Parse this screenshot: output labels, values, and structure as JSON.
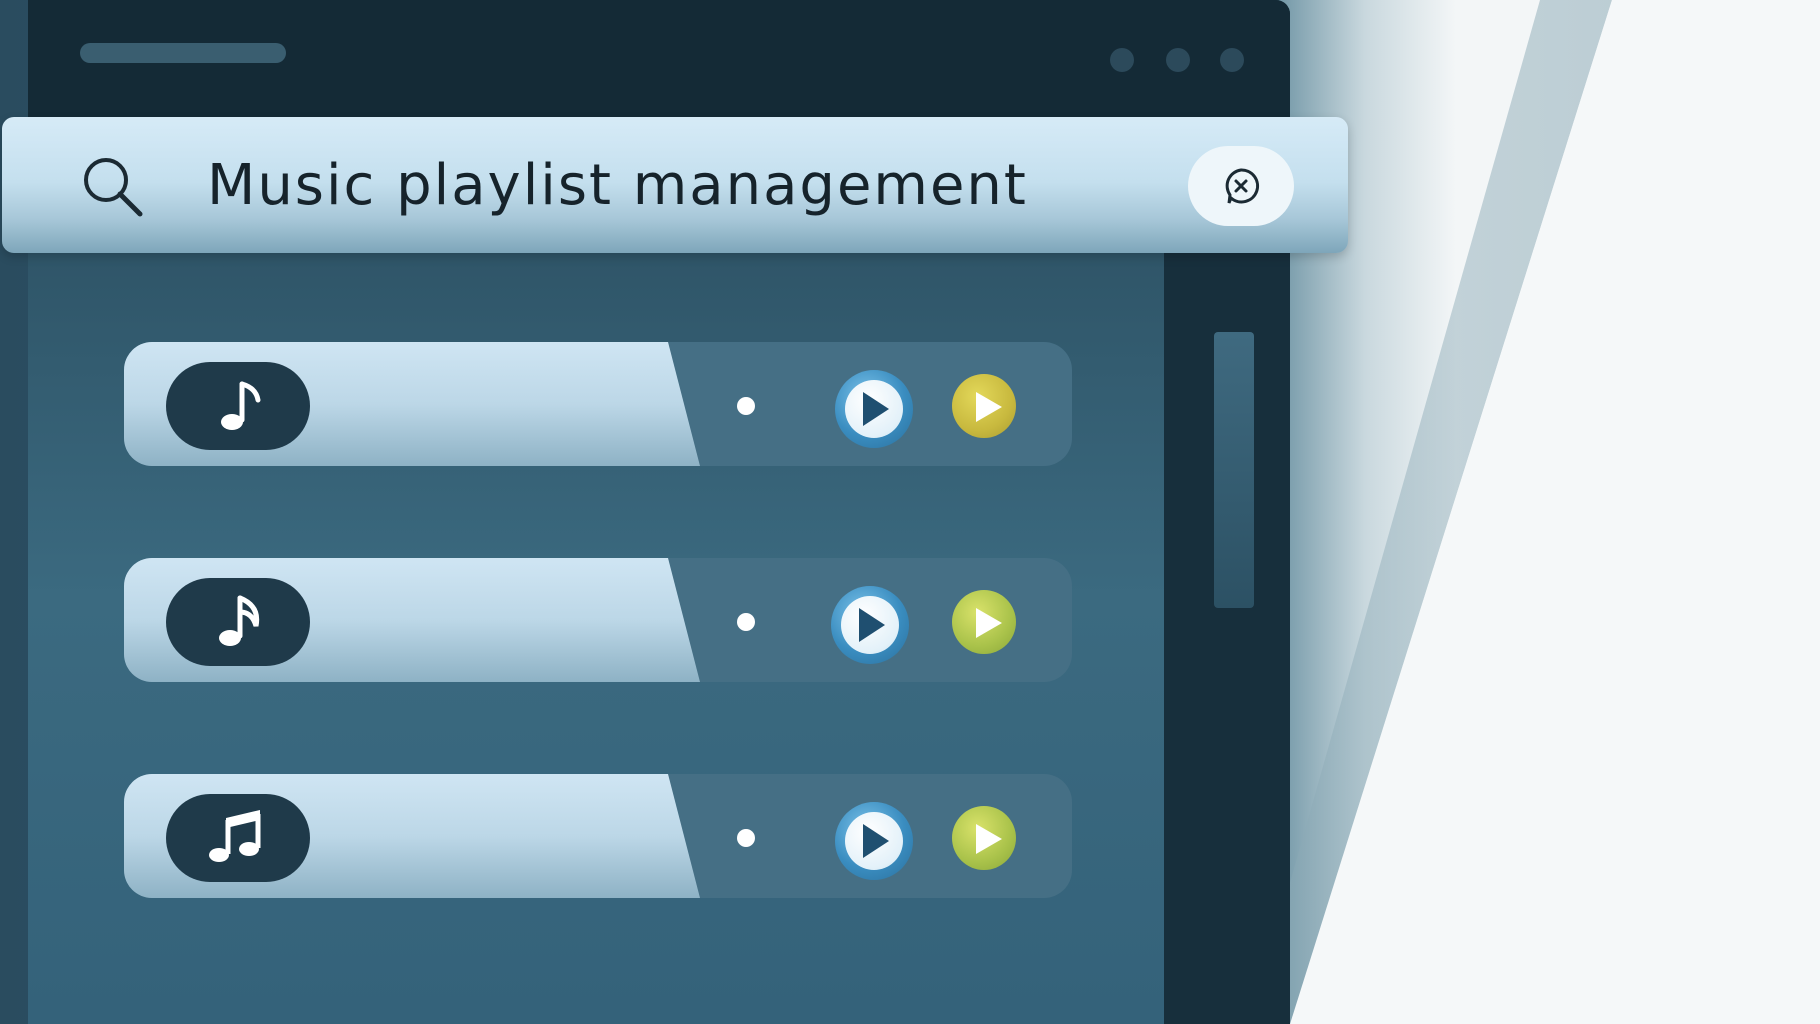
{
  "search": {
    "query": "Music playlist management"
  },
  "tracks": [
    {
      "icon": "music-note-icon",
      "play_color": "#c8b93e"
    },
    {
      "icon": "music-note-icon",
      "play_color": "#a9c24a"
    },
    {
      "icon": "beamed-notes-icon",
      "play_color": "#a9c24a"
    }
  ],
  "colors": {
    "window": "#1d3948",
    "searchbar": "#c4dfee",
    "play_accent": "#3a8dc0"
  }
}
